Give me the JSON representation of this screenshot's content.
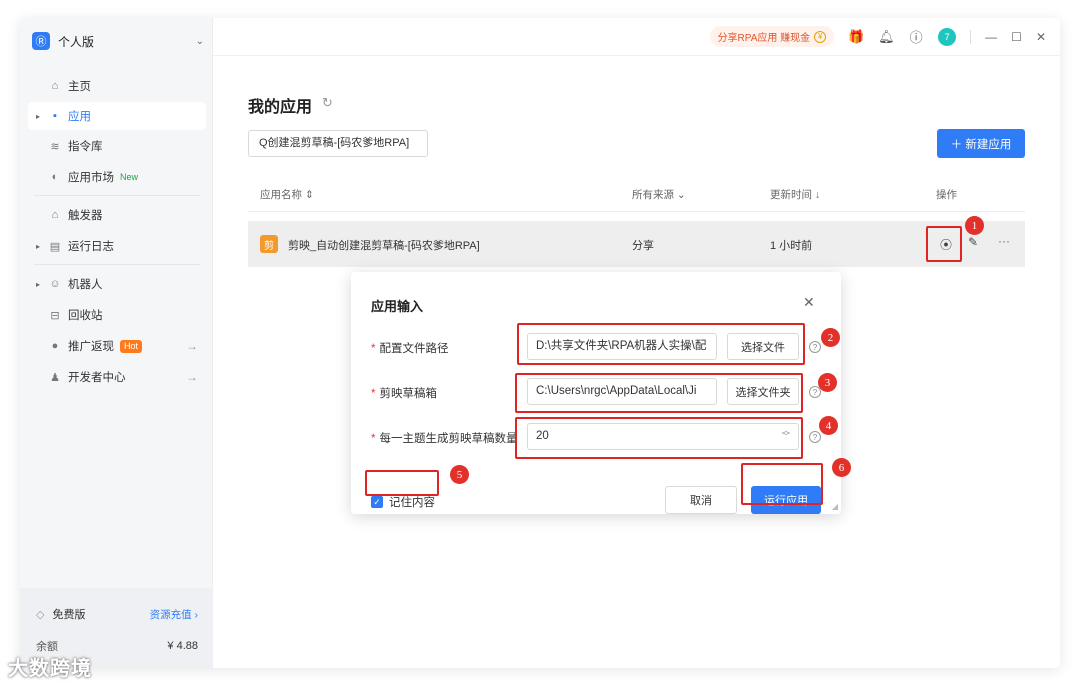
{
  "workspace": {
    "logo": "Ⓡ",
    "name": "个人版",
    "caret": "⌄"
  },
  "sidebar": {
    "items": [
      {
        "label": "主页",
        "icon": "⌂"
      },
      {
        "label": "应用",
        "icon": "▪"
      },
      {
        "label": "指令库",
        "icon": "≋"
      },
      {
        "label": "应用市场",
        "icon": "◐",
        "tag": "New"
      },
      {
        "label": "触发器",
        "icon": "⌂"
      },
      {
        "label": "运行日志",
        "icon": "▤"
      },
      {
        "label": "机器人",
        "icon": "☺"
      },
      {
        "label": "回收站",
        "icon": "⊟"
      },
      {
        "label": "推广返现",
        "icon": "●",
        "tag": "Hot",
        "arrow": "→"
      },
      {
        "label": "开发者中心",
        "icon": "♟",
        "arrow": "→"
      }
    ],
    "plan": {
      "name": "免费版",
      "recharge": "资源充值 ›",
      "balance_label": "余额",
      "balance": "¥ 4.88"
    }
  },
  "topbar": {
    "share": "分享RPA应用 赚现金",
    "coin": "¥",
    "avatar": "7",
    "gift": "🎁",
    "bell": "♫",
    "help": "?",
    "minimize": "—",
    "maximize": "☐",
    "close": "✕"
  },
  "main": {
    "title": "我的应用",
    "refresh": "↻",
    "search_value": "Q创建混剪草稿-[码农爹地RPA]",
    "new_button": "＋ 新建应用",
    "columns": {
      "name": "应用名称 ⇕",
      "source": "所有来源 ⌄",
      "updated": "更新时间 ↓",
      "ops": "操作"
    },
    "row": {
      "icon": "剪",
      "name": "剪映_自动创建混剪草稿-[码农爹地RPA]",
      "source": "分享",
      "updated": "1 小时前",
      "run": "▶",
      "edit": "✎",
      "more": "···"
    }
  },
  "modal": {
    "title": "应用输入",
    "close": "✕",
    "fields": [
      {
        "label": "配置文件路径",
        "value": "D:\\共享文件夹\\RPA机器人实操\\配",
        "button": "选择文件"
      },
      {
        "label": "剪映草稿箱",
        "value": "C:\\Users\\nrgc\\AppData\\Local\\Ji",
        "button": "选择文件夹"
      },
      {
        "label": "每一主题生成剪映草稿数量",
        "value": "20"
      }
    ],
    "required_mark": "*",
    "help": "?",
    "stepper_up": "︿",
    "stepper_down": "﹀",
    "remember_label": "记住内容",
    "check": "✓",
    "cancel": "取消",
    "run": "运行应用"
  },
  "annotations": [
    "1",
    "2",
    "3",
    "4",
    "5",
    "6"
  ],
  "watermark": "大数跨境"
}
